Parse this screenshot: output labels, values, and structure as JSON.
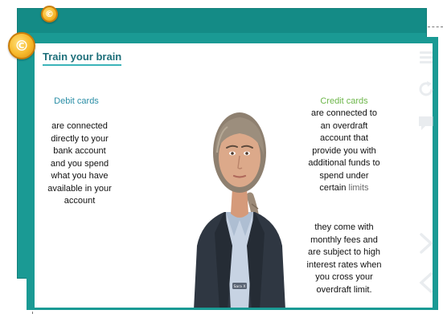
{
  "coins": {
    "symbol": "©"
  },
  "page": {
    "title": "Train your brain"
  },
  "debit": {
    "heading": "Debit cards",
    "body": [
      "are connected",
      "directly to your",
      "bank account",
      "and you spend",
      "what you have",
      "available in your",
      "account"
    ]
  },
  "credit": {
    "heading": "Credit cards",
    "body": [
      "are connected to",
      "an overdraft",
      "account that",
      "provide you with",
      "additional funds to",
      "spend under"
    ],
    "body_last_strong": "certain",
    "body_last_rest": " limits",
    "body2": [
      "they come with",
      "monthly fees and",
      "are subject to high",
      "interest rates when",
      "you cross your",
      "overdraft limit."
    ]
  },
  "avatar": {
    "badge": "Sara X"
  },
  "icons": [
    "menu-icon",
    "refresh-icon",
    "chat-icon",
    "next-icon",
    "previous-icon"
  ],
  "colors": {
    "frame": "#1a9a94",
    "title": "#1e6f7a",
    "debit_heading": "#2a8ea6",
    "credit_heading": "#6db64a"
  }
}
